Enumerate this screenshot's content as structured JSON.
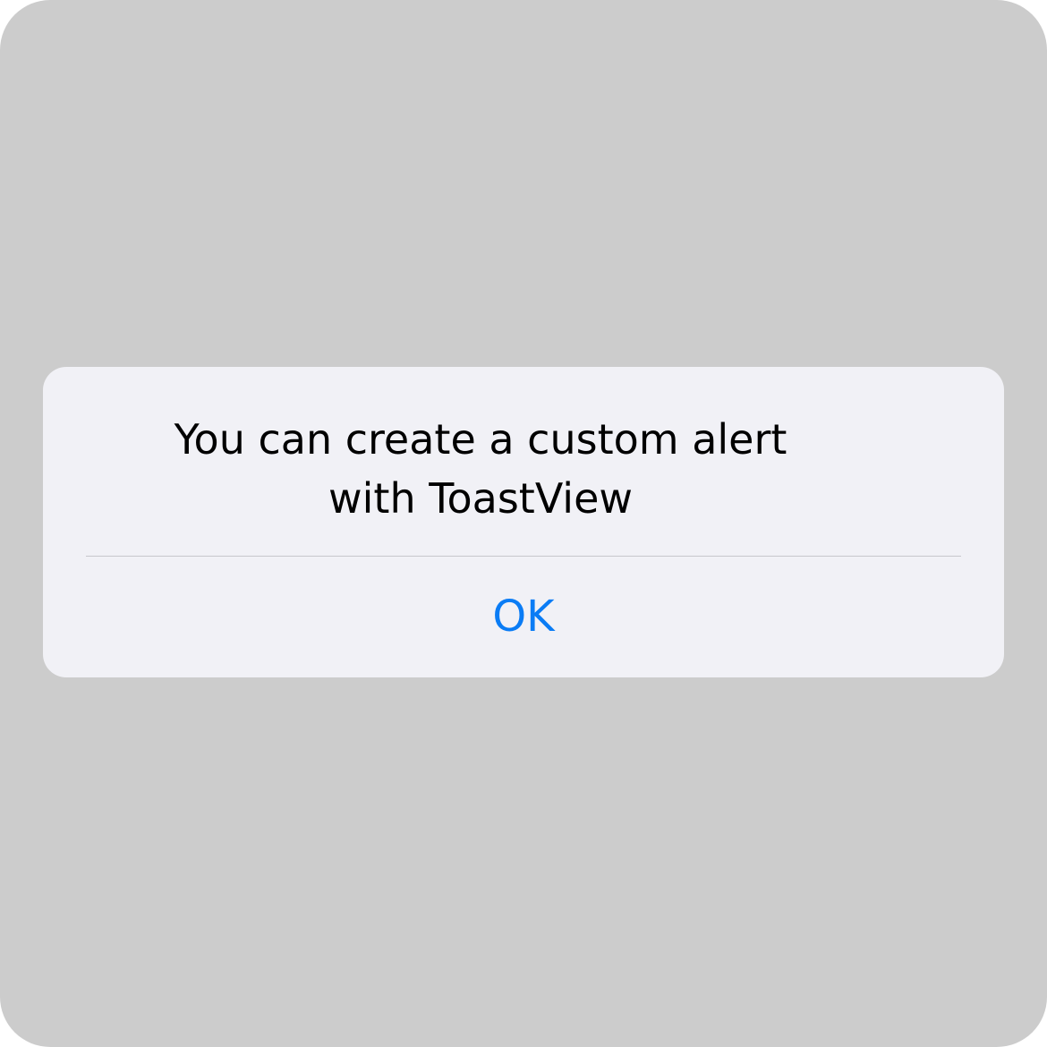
{
  "alert": {
    "message_line1": "You can create a custom alert",
    "message_line2": "with ToastView",
    "ok_label": "OK"
  },
  "colors": {
    "backdrop": "#cccccc",
    "alert_background": "#f1f1f6",
    "divider": "#c7c7cc",
    "accent": "#0a7cf5",
    "message_text": "#000000"
  }
}
